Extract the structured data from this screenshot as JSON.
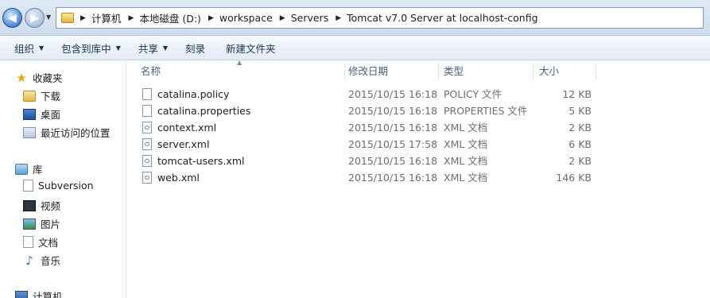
{
  "address": {
    "crumbs": [
      "计算机",
      "本地磁盘 (D:)",
      "workspace",
      "Servers",
      "Tomcat v7.0 Server at localhost-config"
    ]
  },
  "toolbar": {
    "organize": "组织",
    "include_library": "包含到库中",
    "share": "共享",
    "burn": "刻录",
    "new_folder": "新建文件夹"
  },
  "sidebar": {
    "favorites": "收藏夹",
    "downloads": "下载",
    "desktop": "桌面",
    "recent": "最近访问的位置",
    "libraries": "库",
    "subversion": "Subversion",
    "videos": "视频",
    "pictures": "图片",
    "documents": "文档",
    "music": "音乐",
    "computer": "计算机"
  },
  "columns": {
    "name": "名称",
    "date": "修改日期",
    "type": "类型",
    "size": "大小"
  },
  "files": [
    {
      "name": "catalina.policy",
      "date": "2015/10/15 16:18",
      "type": "POLICY 文件",
      "size": "12 KB",
      "icon": "file-icon"
    },
    {
      "name": "catalina.properties",
      "date": "2015/10/15 16:18",
      "type": "PROPERTIES 文件",
      "size": "5 KB",
      "icon": "file-icon"
    },
    {
      "name": "context.xml",
      "date": "2015/10/15 16:18",
      "type": "XML 文档",
      "size": "2 KB",
      "icon": "xml-file-icon"
    },
    {
      "name": "server.xml",
      "date": "2015/10/15 17:58",
      "type": "XML 文档",
      "size": "6 KB",
      "icon": "xml-file-icon"
    },
    {
      "name": "tomcat-users.xml",
      "date": "2015/10/15 16:18",
      "type": "XML 文档",
      "size": "2 KB",
      "icon": "xml-file-icon"
    },
    {
      "name": "web.xml",
      "date": "2015/10/15 16:18",
      "type": "XML 文档",
      "size": "146 KB",
      "icon": "xml-file-icon"
    }
  ]
}
